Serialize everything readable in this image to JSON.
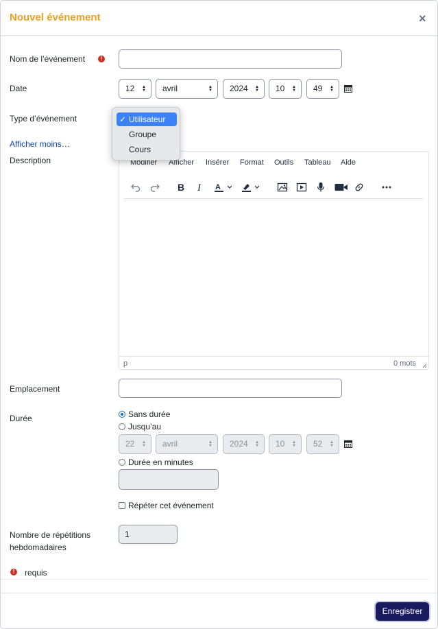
{
  "modal": {
    "title": "Nouvel événement",
    "close_label": "×"
  },
  "form": {
    "name_label": "Nom de l’événement",
    "name_value": "",
    "date_label": "Date",
    "date": {
      "day": "12",
      "month": "avril",
      "year": "2024",
      "hour": "10",
      "minute": "49"
    },
    "type_label": "Type d’événement",
    "type_options": [
      "Utilisateur",
      "Groupe",
      "Cours"
    ],
    "type_selected": "Utilisateur",
    "show_less_link": "Afficher moins…",
    "description_label": "Description",
    "location_label": "Emplacement",
    "location_value": "",
    "duration_label": "Durée",
    "duration_options": {
      "none": "Sans durée",
      "until": "Jusqu’au",
      "minutes": "Durée en minutes"
    },
    "duration_selected": "none",
    "until_date": {
      "day": "22",
      "month": "avril",
      "year": "2024",
      "hour": "10",
      "minute": "52"
    },
    "minutes_value": "",
    "repeat_label": "Répéter cet événement",
    "repeat_checked": false,
    "weekly_repeats_label_1": "Nombre de répétitions",
    "weekly_repeats_label_2": "hebdomadaires",
    "weekly_repeats_value": "1",
    "required_note": "requis"
  },
  "editor": {
    "menu": [
      "Modifier",
      "Afficher",
      "Insérer",
      "Format",
      "Outils",
      "Tableau",
      "Aide"
    ],
    "toolbar_icons": [
      "undo-icon",
      "redo-icon",
      "bold-icon",
      "italic-icon",
      "text-color-icon",
      "highlight-icon",
      "image-icon",
      "media-icon",
      "microphone-icon",
      "video-camera-icon",
      "link-icon",
      "more-icon"
    ],
    "status_element": "p",
    "word_count": "0 mots"
  },
  "footer": {
    "save_label": "Enregistrer"
  },
  "colors": {
    "title": "#f0a020",
    "required": "#ca3120",
    "link": "#0f47ad",
    "primary_button": "#1a1a5e",
    "dropdown_selected": "#3b82f6"
  }
}
